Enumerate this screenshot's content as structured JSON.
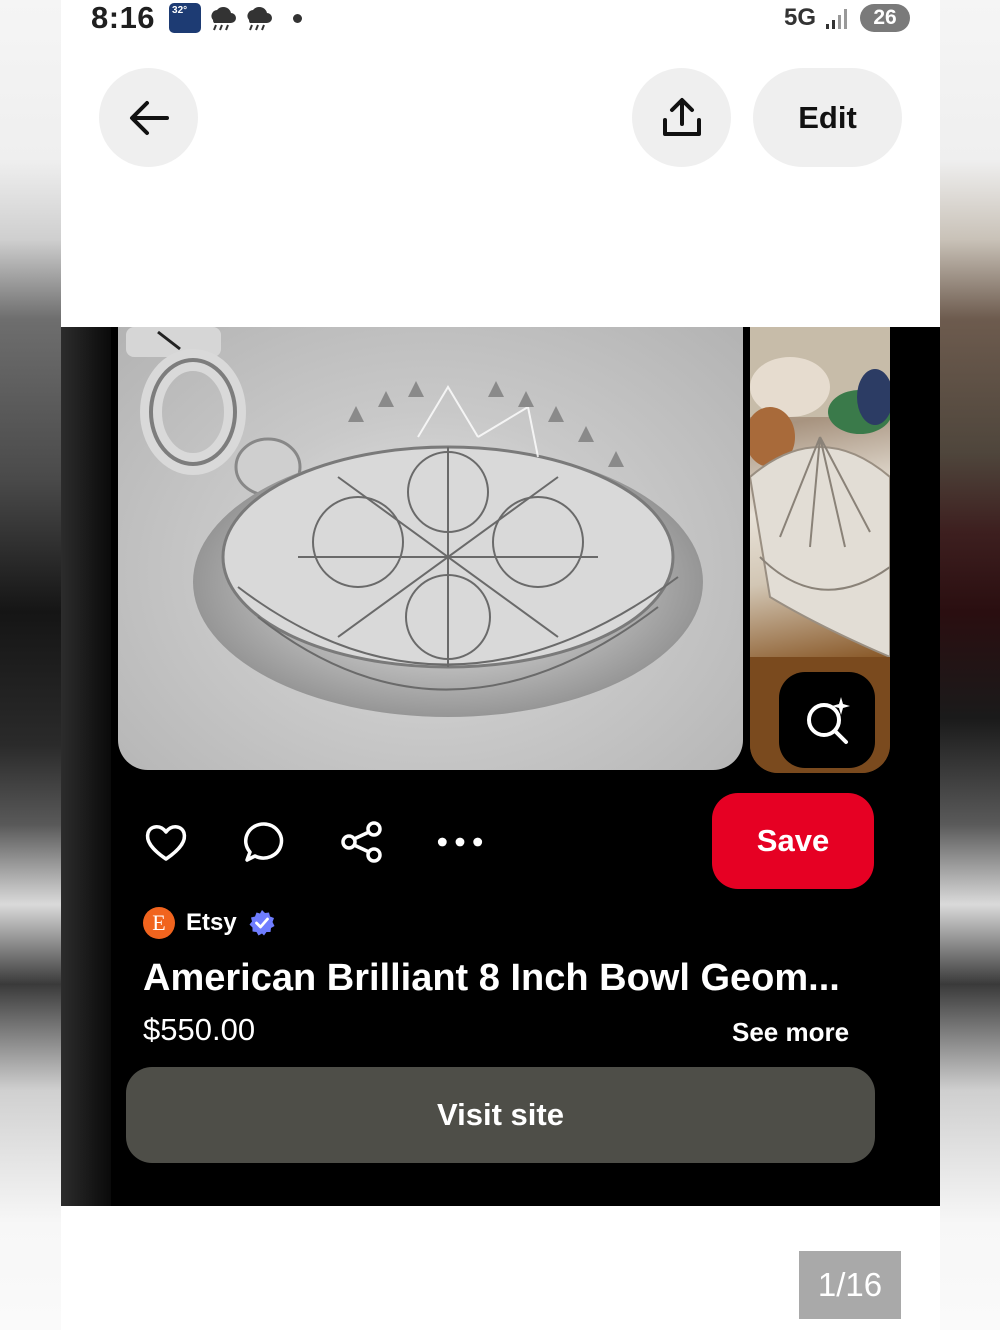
{
  "status_bar": {
    "time": "8:16",
    "weather_temp": "32°",
    "network": "5G",
    "battery": "26"
  },
  "header": {
    "back_icon": "arrow-left-icon",
    "share_icon": "upload-share-icon",
    "edit_label": "Edit"
  },
  "pin": {
    "image_description": "cut crystal bowl",
    "actions": [
      "heart-icon",
      "comment-icon",
      "share-icon",
      "more-icon"
    ],
    "save_label": "Save",
    "source": {
      "logo_letter": "E",
      "name": "Etsy"
    },
    "title": "American Brilliant 8 Inch Bowl Geom...",
    "price": "$550.00",
    "see_more_label": "See more",
    "visit_label": "Visit site"
  },
  "pagination": {
    "label": "1/16"
  },
  "colors": {
    "save_red": "#e60023",
    "etsy_orange": "#f1641e",
    "verified_blue": "#6f7dff",
    "visit_button": "#4e4e48"
  }
}
